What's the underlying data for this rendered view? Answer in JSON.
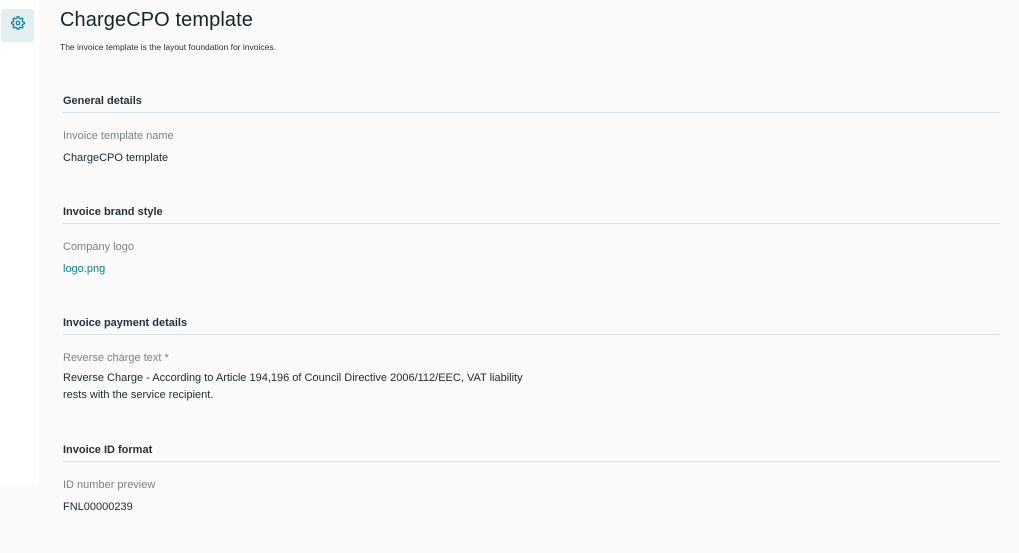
{
  "nav": {
    "settings_icon": "gear-icon"
  },
  "page": {
    "title": "ChargeCPO template",
    "subtitle": "The invoice template is the layout foundation for invoices."
  },
  "sections": {
    "general": {
      "heading": "General details",
      "label": "Invoice template name",
      "value": "ChargeCPO template"
    },
    "brand": {
      "heading": "Invoice brand style",
      "label": "Company logo",
      "value": "logo.png"
    },
    "payment": {
      "heading": "Invoice payment details",
      "label": "Reverse charge text *",
      "value": "Reverse Charge - According to Article 194,196 of Council Directive 2006/112/EEC, VAT liability rests with the service recipient."
    },
    "idformat": {
      "heading": "Invoice ID format",
      "label": "ID number preview",
      "value": "FNL00000239"
    }
  },
  "colors": {
    "accent": "#0f7f96",
    "rail_active_bg": "#e3eff0",
    "divider": "#d4e7e7"
  }
}
